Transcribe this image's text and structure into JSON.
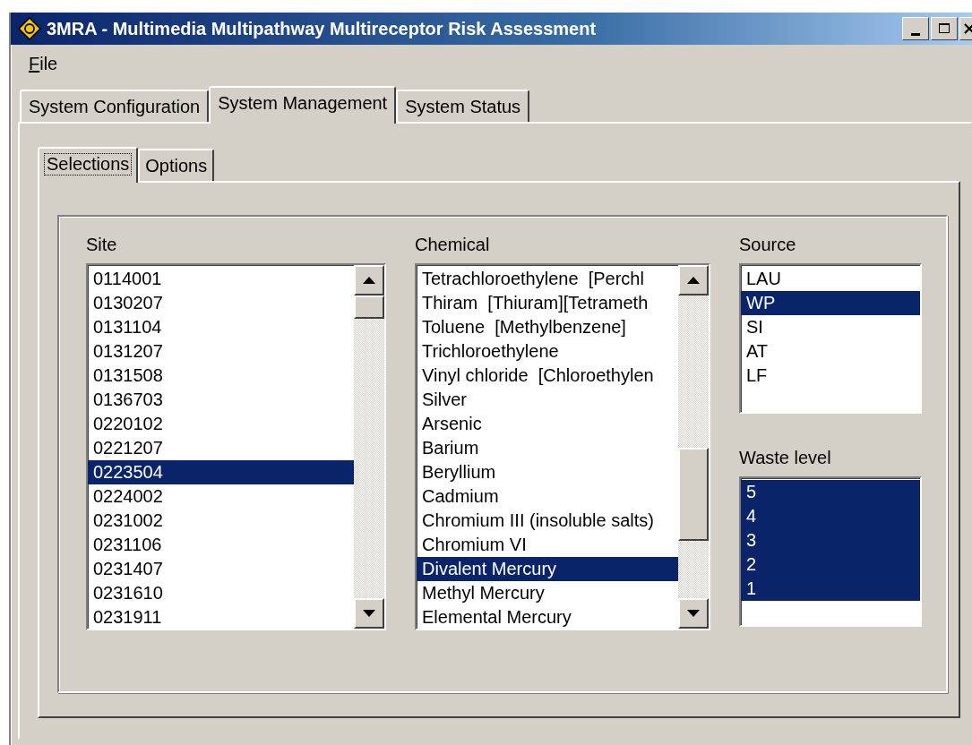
{
  "window": {
    "title": "3MRA - Multimedia Multipathway Multireceptor Risk Assessment"
  },
  "menu": [
    "File"
  ],
  "tabs": [
    {
      "label": "System Configuration",
      "selected": false
    },
    {
      "label": "System Management",
      "selected": true
    },
    {
      "label": "System Status",
      "selected": false
    }
  ],
  "subtabs": [
    {
      "label": "Selections",
      "selected": true
    },
    {
      "label": "Options",
      "selected": false
    }
  ],
  "lists": [
    {
      "label": "Site",
      "kind": "scrolling",
      "items": [
        {
          "text": "0114001",
          "selected": false
        },
        {
          "text": "0130207",
          "selected": false
        },
        {
          "text": "0131104",
          "selected": false
        },
        {
          "text": "0131207",
          "selected": false
        },
        {
          "text": "0131508",
          "selected": false
        },
        {
          "text": "0136703",
          "selected": false
        },
        {
          "text": "0220102",
          "selected": false
        },
        {
          "text": "0221207",
          "selected": false
        },
        {
          "text": "0223504",
          "selected": true
        },
        {
          "text": "0224002",
          "selected": false
        },
        {
          "text": "0231002",
          "selected": false
        },
        {
          "text": "0231106",
          "selected": false
        },
        {
          "text": "0231407",
          "selected": false
        },
        {
          "text": "0231610",
          "selected": false
        },
        {
          "text": "0231911",
          "selected": false
        }
      ]
    },
    {
      "label": "Chemical",
      "kind": "scrolling",
      "items": [
        {
          "text": "Tetrachloroethylene  [Perchl",
          "selected": false
        },
        {
          "text": "Thiram  [Thiuram][Tetrameth",
          "selected": false
        },
        {
          "text": "Toluene  [Methylbenzene]",
          "selected": false
        },
        {
          "text": "Trichloroethylene",
          "selected": false
        },
        {
          "text": "Vinyl chloride  [Chloroethylen",
          "selected": false
        },
        {
          "text": "Silver",
          "selected": false
        },
        {
          "text": "Arsenic",
          "selected": false
        },
        {
          "text": "Barium",
          "selected": false
        },
        {
          "text": "Beryllium",
          "selected": false
        },
        {
          "text": "Cadmium",
          "selected": false
        },
        {
          "text": "Chromium III (insoluble salts)",
          "selected": false
        },
        {
          "text": "Chromium VI",
          "selected": false
        },
        {
          "text": "Divalent Mercury",
          "selected": true
        },
        {
          "text": "Methyl Mercury",
          "selected": false
        },
        {
          "text": "Elemental Mercury",
          "selected": false
        }
      ]
    },
    {
      "label": "Source",
      "kind": "plain",
      "items": [
        {
          "text": "LAU",
          "selected": false
        },
        {
          "text": "WP",
          "selected": true
        },
        {
          "text": "SI",
          "selected": false
        },
        {
          "text": "AT",
          "selected": false
        },
        {
          "text": "LF",
          "selected": false
        }
      ]
    },
    {
      "label": "Waste level",
      "kind": "plain",
      "items": [
        {
          "text": "5",
          "selected": true
        },
        {
          "text": "4",
          "selected": true
        },
        {
          "text": "3",
          "selected": true
        },
        {
          "text": "2",
          "selected": true
        },
        {
          "text": "1",
          "selected": true
        }
      ]
    }
  ]
}
